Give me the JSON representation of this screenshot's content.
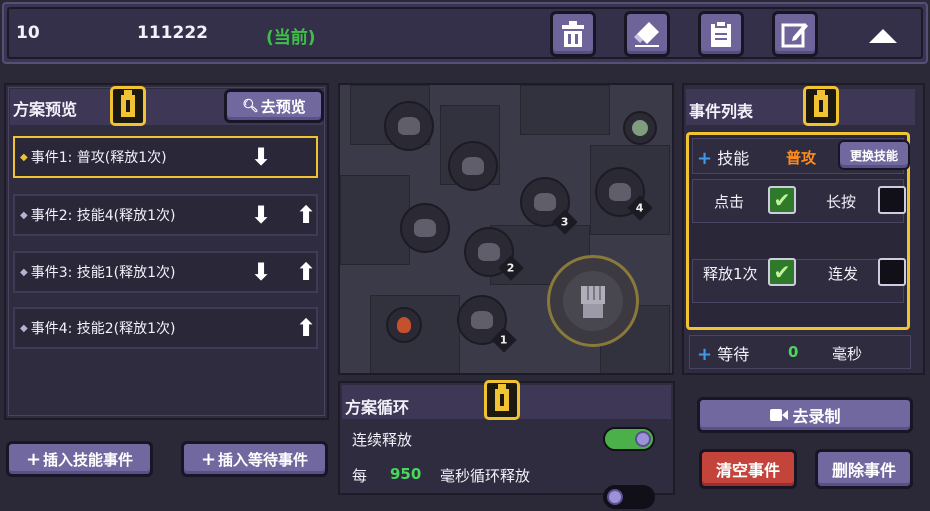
{
  "topbar": {
    "slot_number": "10",
    "scheme_name": "111222",
    "current_tag": "(当前)",
    "buttons": [
      {
        "icon": "trash-icon"
      },
      {
        "icon": "eraser-icon"
      },
      {
        "icon": "clipboard-icon"
      },
      {
        "icon": "edit-share-icon"
      }
    ],
    "collapse_icon": "chevron-up-icon"
  },
  "preview_panel": {
    "title": "方案预览",
    "goto_preview_label": "去预览",
    "events": [
      {
        "label": "事件1:  普攻(释放1次)",
        "down": true,
        "up": false,
        "active": true
      },
      {
        "label": "事件2:  技能4(释放1次)",
        "down": true,
        "up": true,
        "active": false
      },
      {
        "label": "事件3:  技能1(释放1次)",
        "down": true,
        "up": true,
        "active": false
      },
      {
        "label": "事件4:  技能2(释放1次)",
        "down": false,
        "up": true,
        "active": false
      }
    ],
    "insert_skill_label": "插入技能事件",
    "insert_wait_label": "插入等待事件"
  },
  "map": {
    "slot_badges": [
      "3",
      "4",
      "2",
      "1"
    ]
  },
  "event_list": {
    "title": "事件列表",
    "skill_label": "技能",
    "skill_value": "普攻",
    "change_skill_label": "更换技能",
    "click_label": "点击",
    "long_press_label": "长按",
    "release_once_label": "释放1次",
    "combo_label": "连发",
    "wait_label": "等待",
    "wait_value": "0",
    "wait_unit": "毫秒",
    "checks": {
      "click": true,
      "long_press": false,
      "release_once": true,
      "combo": false
    }
  },
  "loop_panel": {
    "title": "方案循环",
    "continuous_label": "连续释放",
    "continuous_on": true,
    "every_label": "每",
    "interval_value": "950",
    "interval_suffix": "毫秒循环释放",
    "interval_on": false
  },
  "actions": {
    "record_label": "去录制",
    "clear_label": "清空事件",
    "delete_label": "删除事件"
  },
  "colors": {
    "accent_yellow": "#f1c232",
    "current_green": "#3fbf4a",
    "skill_orange": "#ff8c1a",
    "value_green": "#48d85a",
    "danger_red": "#c4443c"
  }
}
